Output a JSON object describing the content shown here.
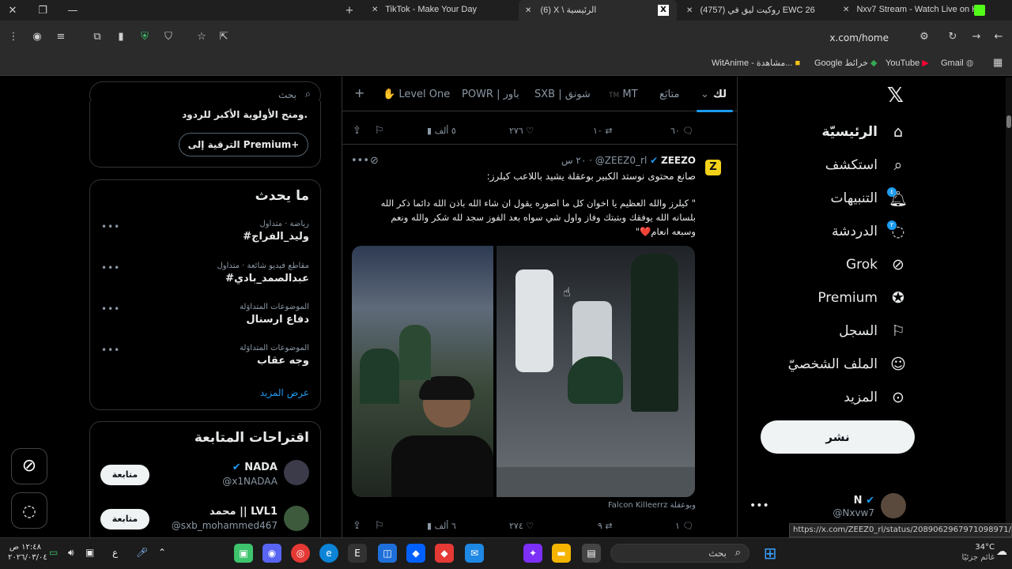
{
  "browser": {
    "tabs": [
      {
        "title": "TikTok - Make Your Day"
      },
      {
        "title": "(6) X \\ الرئيسية"
      },
      {
        "title": "(4757) روكيت ليق في EWC 26"
      },
      {
        "title": "Nxv7 Stream - Watch Live on K"
      }
    ],
    "url": "x.com/home",
    "bookmarks": [
      "Gmail",
      "YouTube",
      "Google خرائط",
      "WitAnime - مشاهدة..."
    ],
    "status_url": "https://x.com/ZEEZ0_rl/status/2089062967971098971/photo/1"
  },
  "nav": {
    "items": [
      {
        "label": "الرئيسيّة",
        "icon": "home-icon"
      },
      {
        "label": "استكشف",
        "icon": "search-icon"
      },
      {
        "label": "التنبيهات",
        "icon": "bell-icon",
        "badge": "٤"
      },
      {
        "label": "الدردشة",
        "icon": "chat-icon",
        "badge": "٢"
      },
      {
        "label": "Grok",
        "icon": "grok-icon"
      },
      {
        "label": "Premium",
        "icon": "verified-icon"
      },
      {
        "label": "السجل",
        "icon": "bookmark-icon"
      },
      {
        "label": "الملف الشخصيّ",
        "icon": "profile-icon"
      },
      {
        "label": "المزيد",
        "icon": "more-icon"
      }
    ],
    "post_label": "نشر",
    "account": {
      "name": "N",
      "handle": "@Nxvw7"
    }
  },
  "feed": {
    "tabs": [
      "لك",
      "متابَع",
      "MT",
      "SXB | شونق",
      "POWR | باور",
      "Level One"
    ],
    "prev_post_actions": {
      "replies": "٦٠",
      "reposts": "١٠",
      "likes": "٢٧٦",
      "views": "٥ ألف"
    },
    "post": {
      "author": "ZEEZO",
      "handle": "@ZEEZ0_rl",
      "time": "٢٠ س",
      "line1": "صانع محتوى نوستد الكبير بوعقلة يشيد باللاعب كيلرز:",
      "quote1": "\" كيلرز والله العظيم يا اخوان كل ما اصوره يقول ان شاء الله باذن الله دائما ذكر الله",
      "quote2": "بلسانه الله يوفقك وبتبتك وفاز واول شي سواه بعد الفوز سجد لله شكر والله ونعم",
      "quote3": "وسبعه انعام❤️\"",
      "tags": "Falcon Killeerrz وبوعقلة",
      "actions": {
        "replies": "١",
        "reposts": "٩",
        "likes": "٢٧٤",
        "views": "٦ ألف"
      }
    }
  },
  "sidebar": {
    "search_placeholder": "بحث",
    "premium_text": "ومنح الأولوية الأكبر للردود.",
    "premium_button": "الترقية إلى Premium+",
    "trends_title": "ما يحدث",
    "trends": [
      {
        "meta": "رياضة · متداول",
        "name": "#وليد_الفراج"
      },
      {
        "meta": "مقاطع فيديو شائعة · متداول",
        "name": "#عبدالصمد_بادي"
      },
      {
        "meta": "الموضوعات المتداوَلة",
        "name": "دفاع ارسنال"
      },
      {
        "meta": "الموضوعات المتداوَلة",
        "name": "وجه عقاب"
      }
    ],
    "show_more": "عرض المزيد",
    "follow_title": "اقتراحات المتابعة",
    "follow": [
      {
        "name": "NADA",
        "handle": "@x1NADAA",
        "button": "متابعة"
      },
      {
        "name": "محمد || LVL1",
        "handle": "@sxb_mohammed467",
        "button": "متابعة"
      }
    ]
  },
  "taskbar": {
    "search": "بحث",
    "weather_temp": "34°C",
    "weather_desc": "غائم جزئيًا",
    "time": "١٢:٤٨ ص",
    "date": "٢٠٢٦/٠٣/٠٤",
    "lang": "ع"
  },
  "colors": {
    "accent": "#1d9bf0",
    "bg": "#000000",
    "border": "#2f3336",
    "muted": "#8b98a5"
  }
}
